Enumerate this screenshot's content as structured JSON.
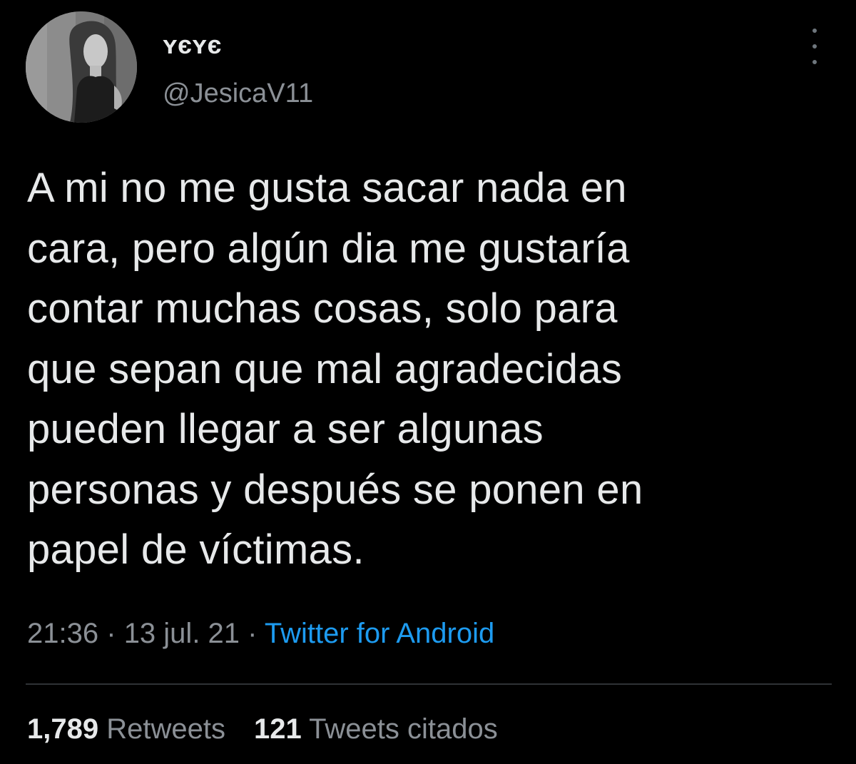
{
  "user": {
    "display_name": "ʏєʏє",
    "handle": "@JesicaV11"
  },
  "tweet": {
    "text": "A mi no me gusta sacar nada en\ncara, pero algún dia me gustaría\ncontar muchas cosas, solo para\nque sepan que mal agradecidas\npueden llegar a ser algunas\npersonas y después se ponen en\npapel de víctimas.",
    "time": "21:36",
    "separator": "·",
    "date": "13 jul. 21",
    "source": "Twitter for Android"
  },
  "stats": {
    "retweets_count": "1,789",
    "retweets_label": "Retweets",
    "quotes_count": "121",
    "quotes_label": "Tweets citados"
  },
  "icons": {
    "more": "more-vertical-icon"
  },
  "colors": {
    "background": "#000000",
    "text": "#e7e9ea",
    "secondary": "#8b9096",
    "link": "#1d9bf0",
    "divider": "#2f3336"
  }
}
